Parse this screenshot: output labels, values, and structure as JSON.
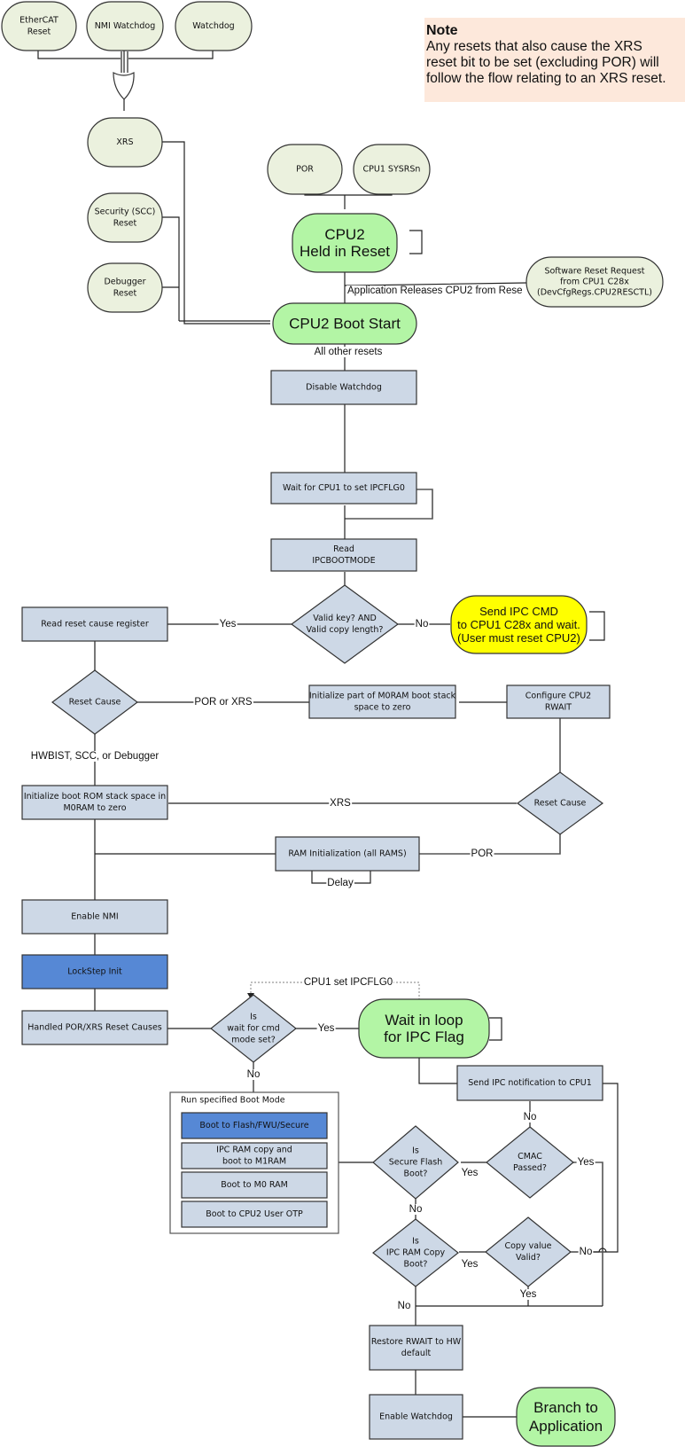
{
  "note": {
    "title": "Note",
    "body": "Any resets that also cause the XRS reset bit to be set (excluding POR) will follow the flow relating to an XRS reset.",
    "lines": [
      "Any resets that also cause the XRS",
      "reset bit to be set (excluding POR) will",
      "follow the flow relating to an XRS reset."
    ]
  },
  "colors": {
    "terminal_pale": "#ebf1de",
    "terminal_green": "#b3f5a5",
    "process": "#cdd8e6",
    "process_highlight": "#5688d5",
    "yellow": "#ffff00",
    "note_bg": "#fde8db"
  },
  "nodes": {
    "ethercat": [
      "EtherCAT",
      "Reset"
    ],
    "nmi_wd": [
      "NMI Watchdog"
    ],
    "watchdog": [
      "Watchdog"
    ],
    "xrs": [
      "XRS"
    ],
    "scc": [
      "Security (SCC)",
      "Reset"
    ],
    "debugger": [
      "Debugger",
      "Reset"
    ],
    "por": [
      "POR"
    ],
    "cpu1_sysrsn": [
      "CPU1 SYSRSn"
    ],
    "cpu2_held": [
      "CPU2",
      "Held in Reset"
    ],
    "sw_reset": [
      "Software Reset Request",
      "from CPU1 C28x",
      "(DevCfgRegs.CPU2RESCTL)"
    ],
    "boot_start": [
      "CPU2 Boot Start"
    ],
    "disable_wd": [
      "Disable Watchdog"
    ],
    "wait_cpu1": [
      "Wait for CPU1 to set IPCFLG0"
    ],
    "read_bootmode": [
      "Read",
      "IPCBOOTMODE"
    ],
    "valid_key": [
      "Valid key? AND",
      "Valid copy length?"
    ],
    "send_ipc_cmd": [
      "Send IPC CMD",
      "to CPU1 C28x and wait.",
      "(User must reset CPU2)"
    ],
    "read_reset_cause": [
      "Read reset cause register"
    ],
    "reset_cause_1": [
      "Reset Cause"
    ],
    "init_part_m0ram": [
      "Initialize part of M0RAM boot stack",
      "space to zero"
    ],
    "config_cpu2": [
      "Configure CPU2",
      "RWAIT"
    ],
    "init_boot_rom": [
      "Initialize boot ROM stack space in",
      "M0RAM to zero"
    ],
    "reset_cause_2": [
      "Reset Cause"
    ],
    "ram_init": [
      "RAM Initialization (all RAMS)"
    ],
    "enable_nmi": [
      "Enable NMI"
    ],
    "lockstep": [
      "LockStep Init"
    ],
    "handled_por": [
      "Handled POR/XRS Reset Causes"
    ],
    "wait_cmd": [
      "Is",
      "wait for cmd",
      "mode set?"
    ],
    "wait_loop": [
      "Wait in loop",
      "for IPC Flag"
    ],
    "send_ipc_notif": [
      "Send IPC notification to CPU1"
    ],
    "run_boot_mode": [
      "Run specified Boot Mode"
    ],
    "boot_flash": [
      "Boot to Flash/FWU/Secure"
    ],
    "boot_ipc_ram": [
      "IPC RAM copy and",
      "boot to M1RAM"
    ],
    "boot_m0": [
      "Boot to M0 RAM"
    ],
    "boot_otp": [
      "Boot to CPU2 User OTP"
    ],
    "secure_flash": [
      "Is",
      "Secure Flash",
      "Boot?"
    ],
    "cmac": [
      "CMAC",
      "Passed?"
    ],
    "ipc_ram_copy": [
      "Is",
      "IPC RAM Copy",
      "Boot?"
    ],
    "copy_valid": [
      "Copy value",
      "Valid?"
    ],
    "restore_rwait": [
      "Restore RWAIT to HW",
      "default"
    ],
    "enable_wd": [
      "Enable Watchdog"
    ],
    "branch_app": [
      "Branch to",
      "Application"
    ]
  },
  "edge_labels": {
    "app_releases": "Application Releases CPU2 from Rese",
    "all_other": "All other resets",
    "yes_valid": "Yes",
    "no_valid": "No",
    "por_or_xrs": "POR or XRS",
    "hwbist": "HWBIST, SCC, or Debugger",
    "xrs": "XRS",
    "por": "POR",
    "delay": "Delay",
    "cpu1_set": "CPU1 set IPCFLG0",
    "yes_wait": "Yes",
    "no_wait": "No",
    "no_cmac": "No",
    "yes_secure": "Yes",
    "yes_cmac": "Yes",
    "no_secure": "No",
    "yes_ipc": "Yes",
    "no_copy": "No",
    "yes_copy": "Yes",
    "no_ipc": "No"
  }
}
